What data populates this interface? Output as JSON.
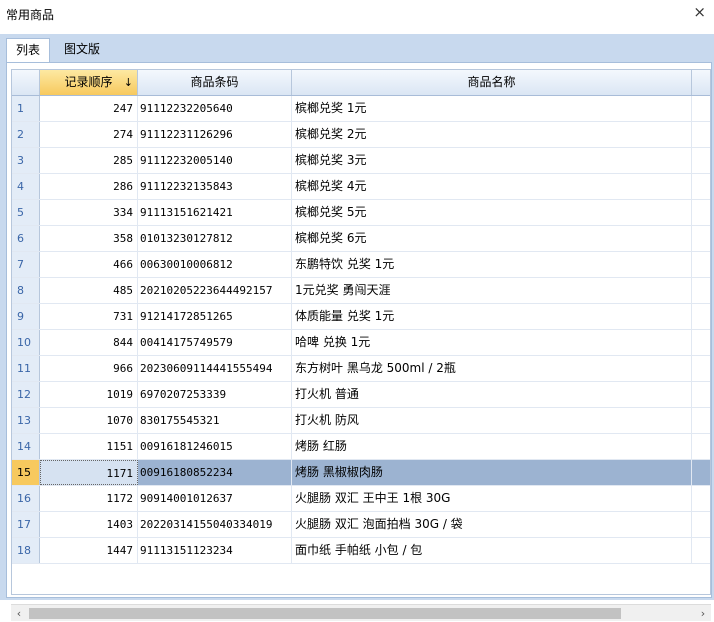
{
  "window": {
    "title": "常用商品",
    "close_icon": "×"
  },
  "tabs": [
    {
      "label": "列表"
    },
    {
      "label": "图文版"
    }
  ],
  "columns": {
    "seq": "记录顺序",
    "barcode": "商品条码",
    "name": "商品名称",
    "sort_icon": "↓"
  },
  "rows": [
    {
      "n": "1",
      "seq": "247",
      "barcode": "91112232205640",
      "name": "槟榔兑奖 1元"
    },
    {
      "n": "2",
      "seq": "274",
      "barcode": "91112231126296",
      "name": "槟榔兑奖 2元"
    },
    {
      "n": "3",
      "seq": "285",
      "barcode": "91112232005140",
      "name": "槟榔兑奖 3元"
    },
    {
      "n": "4",
      "seq": "286",
      "barcode": "91112232135843",
      "name": "槟榔兑奖 4元"
    },
    {
      "n": "5",
      "seq": "334",
      "barcode": "91113151621421",
      "name": "槟榔兑奖 5元"
    },
    {
      "n": "6",
      "seq": "358",
      "barcode": "01013230127812",
      "name": "槟榔兑奖 6元"
    },
    {
      "n": "7",
      "seq": "466",
      "barcode": "00630010006812",
      "name": "东鹏特饮 兑奖 1元"
    },
    {
      "n": "8",
      "seq": "485",
      "barcode": "20210205223644492157",
      "name": "1元兑奖 勇闯天涯"
    },
    {
      "n": "9",
      "seq": "731",
      "barcode": "91214172851265",
      "name": "体质能量 兑奖 1元"
    },
    {
      "n": "10",
      "seq": "844",
      "barcode": "00414175749579",
      "name": "哈啤 兑换 1元"
    },
    {
      "n": "11",
      "seq": "966",
      "barcode": "20230609114441555494",
      "name": "东方树叶 黑乌龙 500ml / 2瓶"
    },
    {
      "n": "12",
      "seq": "1019",
      "barcode": "6970207253339",
      "name": "打火机 普通"
    },
    {
      "n": "13",
      "seq": "1070",
      "barcode": "830175545321",
      "name": "打火机 防风"
    },
    {
      "n": "14",
      "seq": "1151",
      "barcode": "00916181246015",
      "name": "烤肠 红肠"
    },
    {
      "n": "15",
      "seq": "1171",
      "barcode": "00916180852234",
      "name": "烤肠 黑椒椒肉肠",
      "selected": true
    },
    {
      "n": "16",
      "seq": "1172",
      "barcode": "90914001012637",
      "name": "火腿肠 双汇 王中王 1根 30G"
    },
    {
      "n": "17",
      "seq": "1403",
      "barcode": "20220314155040334019",
      "name": "火腿肠 双汇 泡面拍档 30G / 袋"
    },
    {
      "n": "18",
      "seq": "1447",
      "barcode": "91113151123234",
      "name": "面巾纸 手帕纸 小包 / 包"
    }
  ],
  "scrollbar": {
    "left_arrow": "‹",
    "right_arrow": "›"
  }
}
